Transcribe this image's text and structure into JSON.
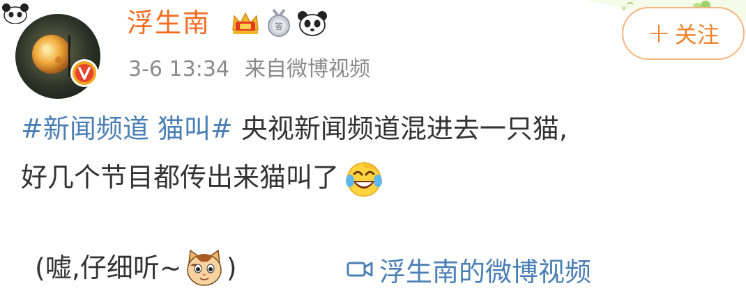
{
  "author": {
    "name": "浮生南",
    "verified_icon": "verified-v-icon",
    "badges": [
      "crown-icon",
      "medal-icon",
      "panda-icon"
    ]
  },
  "meta": {
    "date": "3-6 13:34",
    "source": "来自微博视频"
  },
  "follow_button": {
    "plus": "+",
    "label": "关注"
  },
  "post": {
    "hashtag": "#新闻频道 猫叫#",
    "text_line1": " 央视新闻频道混进去一只猫,",
    "text_line2": "好几个节目都传出来猫叫了",
    "laugh_emoji": "laughing-tears-emoji",
    "line3_open": "(嘘,仔细听~",
    "cat_emoji": "cat-face-emoji",
    "line3_close": ")",
    "video_link_label": "浮生南的微博视频"
  },
  "colors": {
    "username": "#f26b1f",
    "hashtag": "#4a7fb5",
    "follow": "#f0822a",
    "meta": "#8a8a8a"
  }
}
